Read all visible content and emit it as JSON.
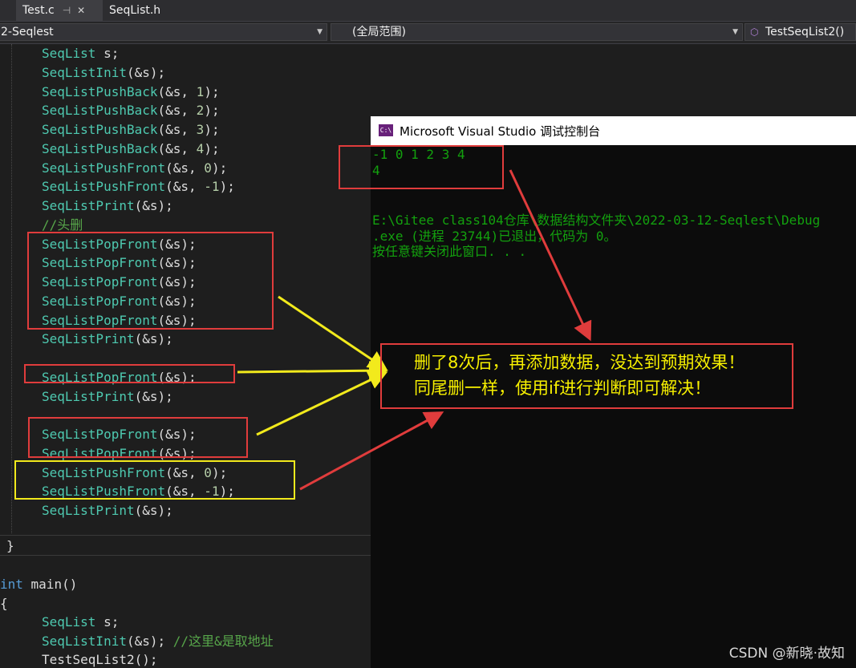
{
  "tabs": [
    {
      "label": "Test.c",
      "pin": "⊣",
      "active": true
    },
    {
      "label": "SeqList.h",
      "active": false
    }
  ],
  "close_glyph": "✕",
  "nav": {
    "project": "2-Seqlest",
    "scope": "(全局范围)",
    "function": "TestSeqList2()"
  },
  "code_lines": [
    {
      "parts": [
        [
          "fn",
          "SeqList"
        ],
        [
          "pl",
          " s;"
        ]
      ]
    },
    {
      "parts": [
        [
          "fn",
          "SeqListInit"
        ],
        [
          "pl",
          "(&s);"
        ]
      ]
    },
    {
      "parts": [
        [
          "fn",
          "SeqListPushBack"
        ],
        [
          "pl",
          "(&s, "
        ],
        [
          "nm",
          "1"
        ],
        [
          "pl",
          ");"
        ]
      ]
    },
    {
      "parts": [
        [
          "fn",
          "SeqListPushBack"
        ],
        [
          "pl",
          "(&s, "
        ],
        [
          "nm",
          "2"
        ],
        [
          "pl",
          ");"
        ]
      ]
    },
    {
      "parts": [
        [
          "fn",
          "SeqListPushBack"
        ],
        [
          "pl",
          "(&s, "
        ],
        [
          "nm",
          "3"
        ],
        [
          "pl",
          ");"
        ]
      ]
    },
    {
      "parts": [
        [
          "fn",
          "SeqListPushBack"
        ],
        [
          "pl",
          "(&s, "
        ],
        [
          "nm",
          "4"
        ],
        [
          "pl",
          ");"
        ]
      ]
    },
    {
      "parts": [
        [
          "fn",
          "SeqListPushFront"
        ],
        [
          "pl",
          "(&s, "
        ],
        [
          "nm",
          "0"
        ],
        [
          "pl",
          ");"
        ]
      ]
    },
    {
      "parts": [
        [
          "fn",
          "SeqListPushFront"
        ],
        [
          "pl",
          "(&s, "
        ],
        [
          "nm",
          "-1"
        ],
        [
          "pl",
          ");"
        ]
      ]
    },
    {
      "parts": [
        [
          "fn",
          "SeqListPrint"
        ],
        [
          "pl",
          "(&s);"
        ]
      ]
    },
    {
      "parts": [
        [
          "cm",
          "//头删"
        ]
      ]
    },
    {
      "parts": [
        [
          "fn",
          "SeqListPopFront"
        ],
        [
          "pl",
          "(&s);"
        ]
      ]
    },
    {
      "parts": [
        [
          "fn",
          "SeqListPopFront"
        ],
        [
          "pl",
          "(&s);"
        ]
      ]
    },
    {
      "parts": [
        [
          "fn",
          "SeqListPopFront"
        ],
        [
          "pl",
          "(&s);"
        ]
      ]
    },
    {
      "parts": [
        [
          "fn",
          "SeqListPopFront"
        ],
        [
          "pl",
          "(&s);"
        ]
      ]
    },
    {
      "parts": [
        [
          "fn",
          "SeqListPopFront"
        ],
        [
          "pl",
          "(&s);"
        ]
      ]
    },
    {
      "parts": [
        [
          "fn",
          "SeqListPrint"
        ],
        [
          "pl",
          "(&s);"
        ]
      ]
    },
    {
      "parts": []
    },
    {
      "parts": [
        [
          "fn",
          "SeqListPopFront"
        ],
        [
          "pl",
          "(&s);"
        ]
      ]
    },
    {
      "parts": [
        [
          "fn",
          "SeqListPrint"
        ],
        [
          "pl",
          "(&s);"
        ]
      ]
    },
    {
      "parts": []
    },
    {
      "parts": [
        [
          "fn",
          "SeqListPopFront"
        ],
        [
          "pl",
          "(&s);"
        ]
      ]
    },
    {
      "parts": [
        [
          "fn",
          "SeqListPopFront"
        ],
        [
          "pl",
          "(&s);"
        ]
      ]
    },
    {
      "parts": [
        [
          "fn",
          "SeqListPushFront"
        ],
        [
          "pl",
          "(&s, "
        ],
        [
          "nm",
          "0"
        ],
        [
          "pl",
          ");"
        ]
      ]
    },
    {
      "parts": [
        [
          "fn",
          "SeqListPushFront"
        ],
        [
          "pl",
          "(&s, "
        ],
        [
          "nm",
          "-1"
        ],
        [
          "pl",
          ");"
        ]
      ]
    },
    {
      "parts": [
        [
          "fn",
          "SeqListPrint"
        ],
        [
          "pl",
          "(&s);"
        ]
      ]
    }
  ],
  "closing_brace": "}",
  "main_lines": [
    {
      "indent": 0,
      "parts": [
        [
          "kw",
          "int"
        ],
        [
          "pl",
          " main()"
        ]
      ]
    },
    {
      "indent": 0,
      "parts": [
        [
          "pl",
          "{"
        ]
      ]
    },
    {
      "indent": 1,
      "parts": [
        [
          "fn",
          "SeqList"
        ],
        [
          "pl",
          " s;"
        ]
      ]
    },
    {
      "indent": 1,
      "parts": [
        [
          "fn",
          "SeqListInit"
        ],
        [
          "pl",
          "(&s); "
        ],
        [
          "cm",
          "//这里&是取地址"
        ]
      ]
    },
    {
      "indent": 1,
      "parts": [
        [
          "pl",
          "TestSeqList2();"
        ]
      ]
    }
  ],
  "console": {
    "title": "Microsoft Visual Studio 调试控制台",
    "icon_text": "C:\\",
    "lines": [
      "-1 0 1 2 3 4",
      "4",
      "",
      "",
      "E:\\Gitee class104仓库\\数据结构文件夹\\2022-03-12-Seqlest\\Debug",
      ".exe (进程 23744)已退出，代码为 0。",
      "按任意键关闭此窗口. . ."
    ]
  },
  "callout": {
    "line1": "删了8次后，再添加数据，没达到预期效果！",
    "line2": "同尾删一样，使用if进行判断即可解决！"
  },
  "watermark": "CSDN @新晓·故知",
  "colors": {
    "annotation_red": "#e03c3c",
    "annotation_yellow": "#f2ea1c",
    "console_green": "#13a10e",
    "callout_text": "#f7f000"
  }
}
